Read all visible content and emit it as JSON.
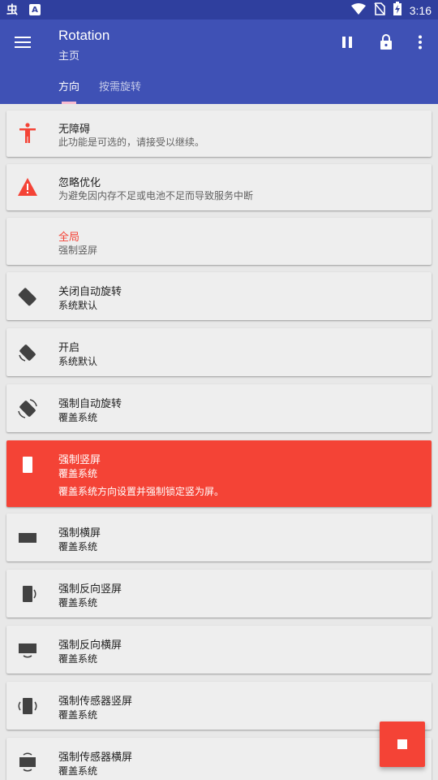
{
  "status_bar": {
    "time": "3:16",
    "left_icons": [
      "bug-icon",
      "a-icon"
    ],
    "right_icons": [
      "wifi-icon",
      "no-sim-icon",
      "battery-charging-icon"
    ]
  },
  "app_bar": {
    "title": "Rotation",
    "subtitle": "主页",
    "actions": [
      "pause-icon",
      "lock-icon",
      "more-vert-icon"
    ],
    "color": "#3f51b5"
  },
  "tabs": [
    {
      "label": "方向",
      "selected": true
    },
    {
      "label": "按需旋转",
      "selected": false
    }
  ],
  "cards": [
    {
      "icon": "accessibility-icon",
      "title": "无障碍",
      "subtitle": "此功能是可选的，请接受以继续。"
    },
    {
      "icon": "warning-icon",
      "title": "忽略优化",
      "subtitle": "为避免因内存不足或电池不足而导致服务中断"
    },
    {
      "icon": "",
      "title": "全局",
      "subtitle": "强制竖屏"
    },
    {
      "icon": "rotation-off-icon",
      "title": "关闭自动旋转",
      "subtitle": "系统默认"
    },
    {
      "icon": "rotation-on-icon",
      "title": "开启",
      "subtitle": "系统默认"
    },
    {
      "icon": "force-rotation-icon",
      "title": "强制自动旋转",
      "subtitle": "覆盖系统"
    },
    {
      "icon": "portrait-icon",
      "title": "强制竖屏",
      "subtitle": "覆盖系统",
      "detail": "覆盖系统方向设置并强制锁定竖为屏。"
    },
    {
      "icon": "landscape-icon",
      "title": "强制横屏",
      "subtitle": "覆盖系统"
    },
    {
      "icon": "reverse-portrait-icon",
      "title": "强制反向竖屏",
      "subtitle": "覆盖系统"
    },
    {
      "icon": "reverse-landscape-icon",
      "title": "强制反向横屏",
      "subtitle": "覆盖系统"
    },
    {
      "icon": "sensor-portrait-icon",
      "title": "强制传感器竖屏",
      "subtitle": "覆盖系统"
    },
    {
      "icon": "sensor-landscape-icon",
      "title": "强制传感器横屏",
      "subtitle": "覆盖系统"
    }
  ],
  "fab": {
    "icon": "stop-icon",
    "color": "#f44336"
  }
}
